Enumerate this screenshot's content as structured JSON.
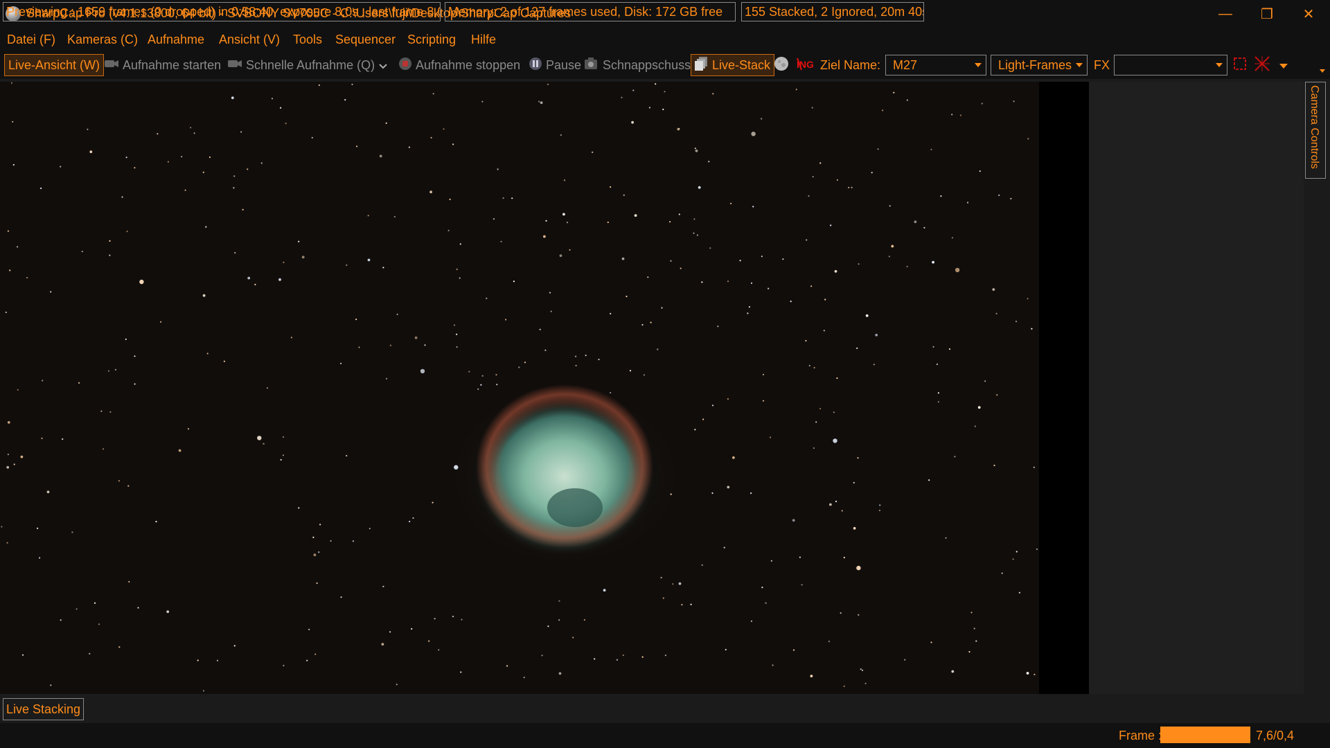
{
  "window": {
    "title": "SharpCap Pro (v4.1.13800, 64 bit) - SVBONY SV705C - C:\\Users\\fuji\\Desktop\\SharpCap Captures",
    "minimize": "—",
    "restore": "❐",
    "close": "✕"
  },
  "menu": [
    "Datei (F)",
    "Kameras (C)",
    "Aufnahme",
    "Ansicht (V)",
    "Tools",
    "Sequencer",
    "Scripting",
    "Hilfe"
  ],
  "toolbar": {
    "live_view": "Live-Ansicht (W)",
    "start_capture": "Aufnahme starten",
    "quick_capture": "Schnelle Aufnahme (Q)",
    "stop_capture": "Aufnahme stoppen",
    "pause": "Pause",
    "snapshot": "Schnappschuss",
    "live_stack": "Live-Stack",
    "target_label": "Ziel Name:",
    "target_value": "M27",
    "frame_type": "Light-Frames",
    "fx_label": "FX",
    "fx_value": ""
  },
  "right_panel": {
    "tab_label": "Camera Controls"
  },
  "bottom_tab": "Live Stacking",
  "status": {
    "preview": "Previewing : 1659 frames (0 dropped) in 0:58:40, exposure 8,0s , last frame 8,0s",
    "memory": "Memory: 2 of 127 frames used, Disk: 172 GB free",
    "stack": "155 Stacked, 2 Ignored, 20m 40s",
    "frame_label": "Frame :",
    "frame_value": "7,6/0,4",
    "frame_progress": 1.0
  },
  "colors": {
    "accent": "#ff8c1a",
    "background": "#1b1b1b",
    "bar": "#111111"
  },
  "icons": [
    "app-logo-icon",
    "camera-icon",
    "record-stop-icon",
    "pause-icon",
    "snapshot-icon",
    "live-stack-icon",
    "moon-icon",
    "dark-frame-icon",
    "zoom-icon",
    "reticle-icon",
    "dropdown-icon"
  ]
}
